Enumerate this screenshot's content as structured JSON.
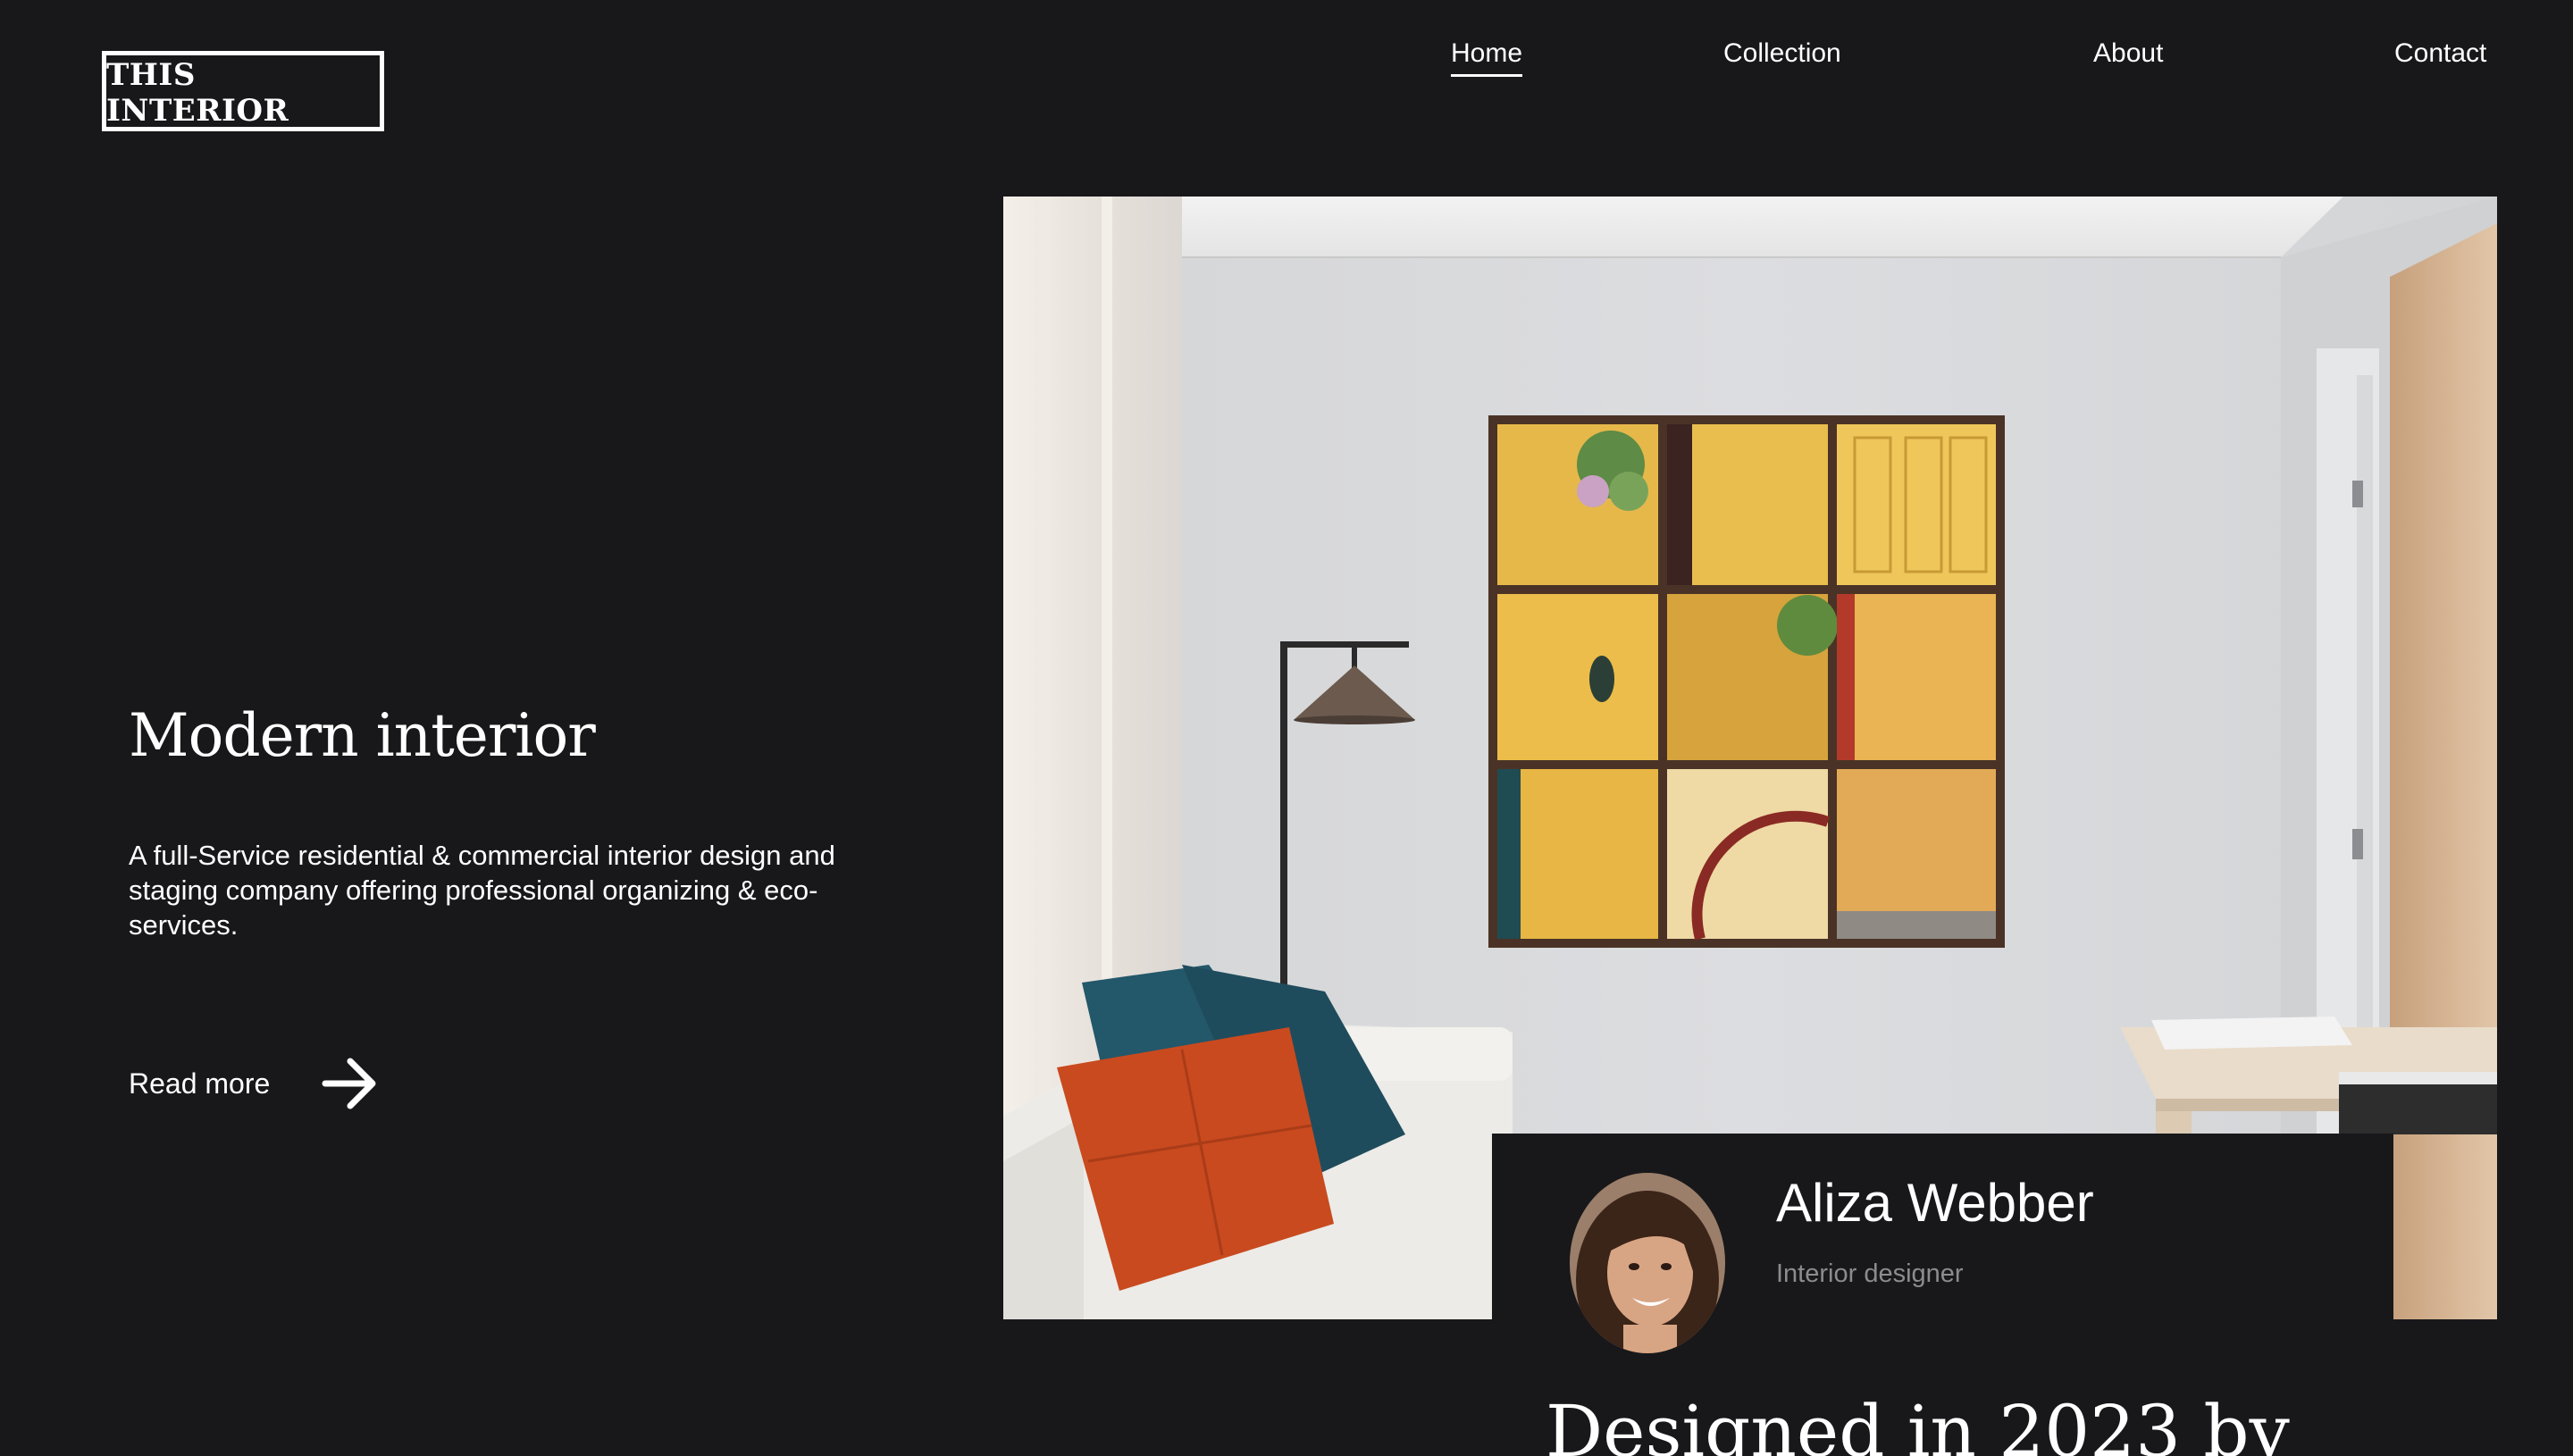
{
  "brand": {
    "logo_text": "THIS INTERIOR"
  },
  "nav": {
    "items": [
      {
        "label": "Home",
        "active": true
      },
      {
        "label": "Collection",
        "active": false
      },
      {
        "label": "About",
        "active": false
      },
      {
        "label": "Contact",
        "active": false
      }
    ]
  },
  "hero": {
    "title": "Modern interior",
    "description": "A full-Service residential & commercial interior design and staging company offering professional organizing & eco-services.",
    "read_more_label": "Read more",
    "arrow_icon": "arrow-right-icon"
  },
  "designer": {
    "name": "Aliza Webber",
    "role": "Interior designer",
    "heading": "Designed in 2023 by"
  },
  "colors": {
    "background": "#18181b",
    "text": "#ffffff",
    "muted_text": "#8c8c90"
  }
}
